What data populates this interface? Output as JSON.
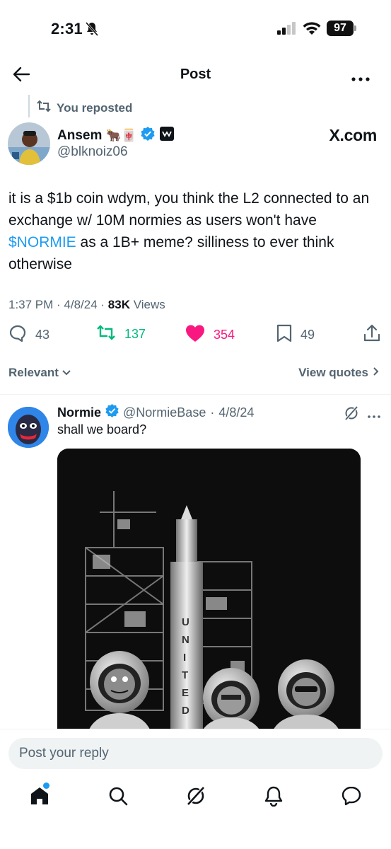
{
  "status_bar": {
    "time": "2:31",
    "battery": "97"
  },
  "header": {
    "title": "Post"
  },
  "repost": {
    "label": "You reposted"
  },
  "tweet": {
    "name": "Ansem",
    "emojis": "🐂🀄",
    "handle": "@blknoiz06",
    "source_label": "X.com",
    "text_before": "it is a $1b coin wdym, you think the L2 connected to an exchange w/ 10M normies as users won't have ",
    "cashtag": "$NORMIE",
    "text_after": " as a 1B+ meme? silliness to ever think otherwise",
    "time": "1:37 PM",
    "date": "4/8/24",
    "views_count": "83K",
    "views_label": "Views",
    "replies": "43",
    "reposts": "137",
    "likes": "354",
    "bookmarks": "49"
  },
  "sort": {
    "relevant": "Relevant",
    "view_quotes": "View quotes"
  },
  "reply": {
    "name": "Normie",
    "handle": "@NormieBase",
    "date": "4/8/24",
    "text": "shall we board?"
  },
  "compose": {
    "placeholder": "Post your reply"
  },
  "colors": {
    "accent": "#1d9bf0",
    "repost": "#00ba7c",
    "like": "#f91880",
    "muted": "#536471"
  },
  "icons": [
    "back-arrow-icon",
    "more-icon",
    "repost-icon",
    "verified-icon",
    "reply-icon",
    "like-icon",
    "bookmark-icon",
    "share-icon",
    "grok-icon",
    "home-icon",
    "search-icon",
    "notifications-icon",
    "messages-icon"
  ]
}
